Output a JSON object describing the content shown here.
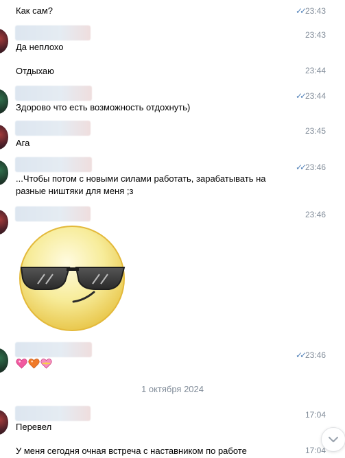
{
  "messages": [
    {
      "text": "Как сам?",
      "time": "23:43",
      "read": "✓✓"
    },
    {
      "text": "Да неплохо",
      "time": "23:43"
    },
    {
      "text": "Отдыхаю",
      "time": "23:44"
    },
    {
      "text": "Здорово что есть возможность отдохнуть)",
      "time": "23:44",
      "read": "✓✓"
    },
    {
      "text": "Ага",
      "time": "23:45"
    },
    {
      "text": "...Чтобы потом с новыми силами работать, зарабатывать на",
      "text2": "разные ништяки для меня ;з",
      "time": "23:46",
      "read": "✓✓"
    },
    {
      "time": "23:46",
      "sticker": "sunglasses-smiley-sticker"
    },
    {
      "time": "23:46",
      "read": "✓✓",
      "hearts": [
        "sparkling-heart-icon",
        "orange-heart-icon",
        "heart-with-ribbon-icon"
      ]
    },
    {
      "text": "Перевел",
      "time": "17:04"
    },
    {
      "text": "У меня сегодня очная встреча с наставником по работе",
      "time": "17:04"
    }
  ],
  "date_separator": "1 октября 2024",
  "colors": {
    "accent": "#5181b8",
    "secondary_text": "#818c99"
  },
  "icons": {
    "read_receipt": "double-check-icon",
    "scroll_down": "chevron-down-icon"
  }
}
